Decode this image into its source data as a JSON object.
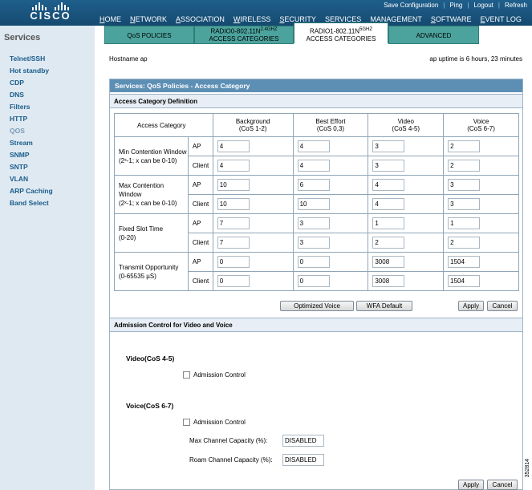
{
  "brand": {
    "logo_text": "CISCO"
  },
  "toplinks": [
    "Save Configuration",
    "Ping",
    "Logout",
    "Refresh"
  ],
  "menu": [
    "HOME",
    "NETWORK",
    "ASSOCIATION",
    "WIRELESS",
    "SECURITY",
    "SERVICES",
    "MANAGEMENT",
    "SOFTWARE",
    "EVENT LOG"
  ],
  "sidebar": {
    "title": "Services",
    "items": [
      "Telnet/SSH",
      "Hot standby",
      "CDP",
      "DNS",
      "Filters",
      "HTTP",
      "QOS",
      "Stream",
      "SNMP",
      "SNTP",
      "VLAN",
      "ARP Caching",
      "Band Select"
    ],
    "active": "QOS"
  },
  "tabs": [
    {
      "l1": "QoS POLICIES",
      "l2": ""
    },
    {
      "l1": "RADIO0-802.11N",
      "sup": "2.4GHZ",
      "l2": "ACCESS CATEGORIES"
    },
    {
      "l1": "RADIO1-802.11N",
      "sup": "5GHZ",
      "l2": "ACCESS CATEGORIES"
    },
    {
      "l1": "ADVANCED",
      "l2": ""
    }
  ],
  "host": {
    "label": "Hostname",
    "name": "ap",
    "uptime": "ap uptime is 6 hours, 23 minutes"
  },
  "panel": {
    "title": "Services: QoS Policies - Access Category",
    "section1": "Access Category Definition",
    "section2": "Admission Control for Video and Voice"
  },
  "table": {
    "header": {
      "ac": "Access Category",
      "cols": [
        {
          "name": "Background",
          "cos": "(CoS 1-2)"
        },
        {
          "name": "Best Effort",
          "cos": "(CoS 0,3)"
        },
        {
          "name": "Video",
          "cos": "(CoS 4-5)"
        },
        {
          "name": "Voice",
          "cos": "(CoS 6-7)"
        }
      ]
    },
    "rows": [
      {
        "label": "Min Contention Window",
        "label2": "(2ˣ-1; x can be 0-10)",
        "ap": [
          "4",
          "4",
          "3",
          "2"
        ],
        "client": [
          "4",
          "4",
          "3",
          "2"
        ]
      },
      {
        "label": "Max Contention Window",
        "label2": "(2ˣ-1; x can be 0-10)",
        "ap": [
          "10",
          "6",
          "4",
          "3"
        ],
        "client": [
          "10",
          "10",
          "4",
          "3"
        ]
      },
      {
        "label": "Fixed Slot Time",
        "label2": "(0-20)",
        "ap": [
          "7",
          "3",
          "1",
          "1"
        ],
        "client": [
          "7",
          "3",
          "2",
          "2"
        ]
      },
      {
        "label": "Transmit Opportunity",
        "label2": "(0-65535 µS)",
        "ap": [
          "0",
          "0",
          "3008",
          "1504"
        ],
        "client": [
          "0",
          "0",
          "3008",
          "1504"
        ]
      }
    ],
    "ap_label": "AP",
    "client_label": "Client"
  },
  "buttons": {
    "optimized": "Optimized Voice",
    "wfa": "WFA Default",
    "apply": "Apply",
    "cancel": "Cancel"
  },
  "admission": {
    "video_title": "Video(CoS 4-5)",
    "voice_title": "Voice(CoS 6-7)",
    "checkbox_label": "Admission Control",
    "max_cap_label": "Max Channel Capacity (%):",
    "max_cap_value": "DISABLED",
    "roam_cap_label": "Roam Channel Capacity (%):",
    "roam_cap_value": "DISABLED"
  },
  "figure_number": "352814"
}
